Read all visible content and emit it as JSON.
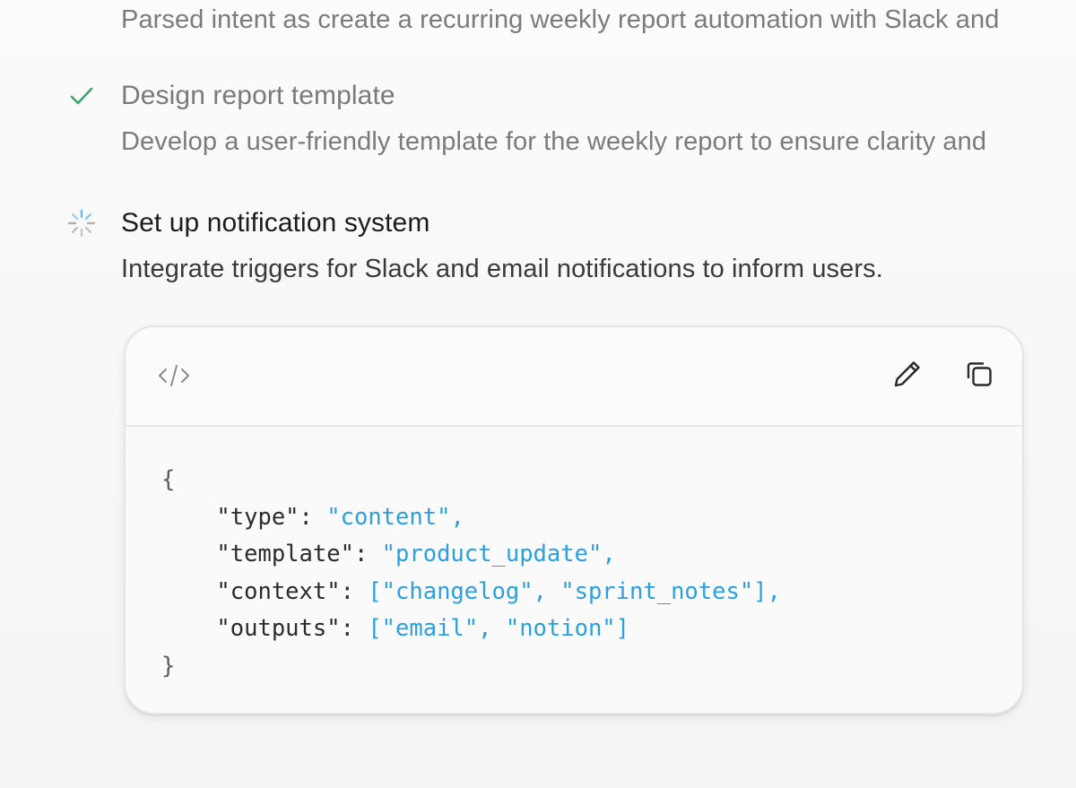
{
  "steps": [
    {
      "status": "done",
      "title": "",
      "description": "Parsed intent as create a recurring weekly report automation with Slack and"
    },
    {
      "status": "done",
      "icon": "check-icon",
      "title": "Design report template",
      "description": "Develop a user-friendly template for the weekly report to ensure clarity and"
    },
    {
      "status": "in-progress",
      "icon": "spinner-icon",
      "title": "Set up notification system",
      "description": "Integrate triggers for Slack and email notifications to inform users."
    }
  ],
  "code_card": {
    "header_icon": "code-icon",
    "actions": [
      {
        "name": "edit",
        "icon": "pencil-icon"
      },
      {
        "name": "copy",
        "icon": "copy-icon"
      }
    ],
    "code": {
      "open_brace": "{",
      "close_brace": "}",
      "lines": [
        {
          "key": "\"type\"",
          "value": "\"content\"",
          "trail": ","
        },
        {
          "key": "\"template\"",
          "value": "\"product_update\"",
          "trail": ","
        },
        {
          "key": "\"context\"",
          "value": "[\"changelog\", \"sprint_notes\"]",
          "trail": ","
        },
        {
          "key": "\"outputs\"",
          "value": "[\"email\", \"notion\"]",
          "trail": ""
        }
      ]
    }
  },
  "colors": {
    "check": "#3aa56f",
    "code_string": "#2c9fdc",
    "spinner": "#6fb6e6"
  }
}
